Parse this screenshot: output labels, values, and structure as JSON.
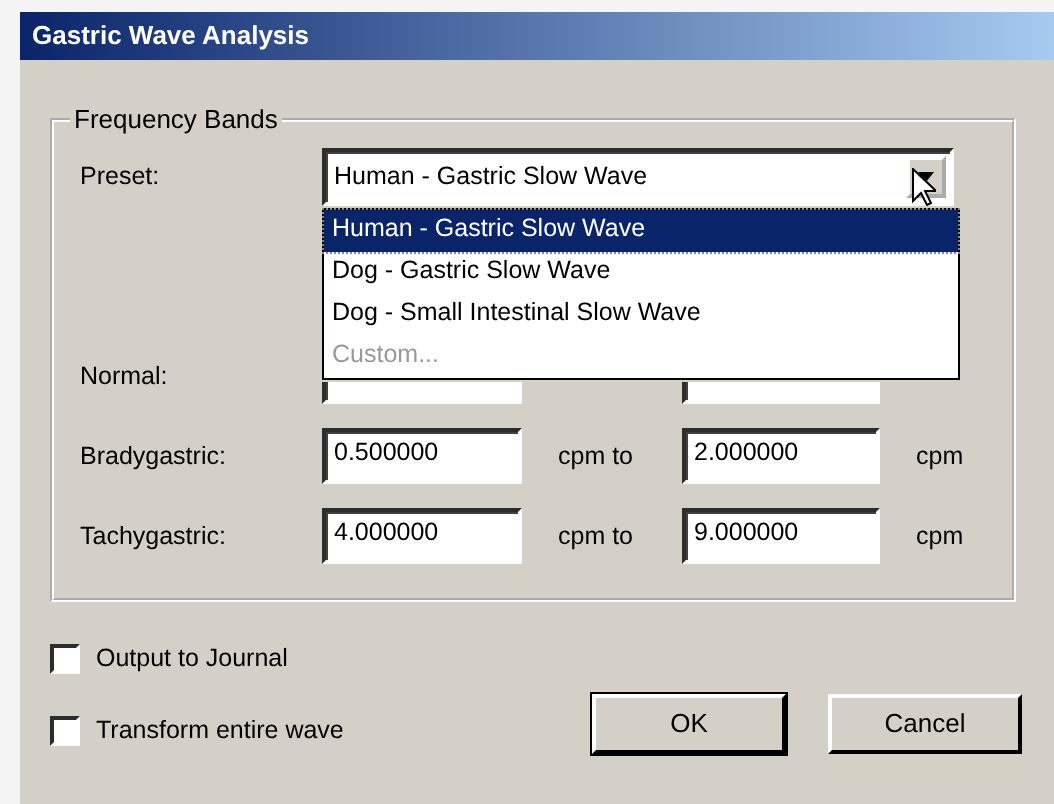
{
  "window": {
    "title": "Gastric Wave Analysis"
  },
  "group": {
    "title": "Frequency Bands"
  },
  "preset": {
    "label": "Preset:",
    "value": "Human - Gastric Slow Wave",
    "expanded": true,
    "options": [
      {
        "label": "Human - Gastric Slow Wave",
        "selected": true,
        "disabled": false
      },
      {
        "label": "Dog - Gastric Slow Wave",
        "selected": false,
        "disabled": false
      },
      {
        "label": "Dog - Small Intestinal Slow Wave",
        "selected": false,
        "disabled": false
      },
      {
        "label": "Custom...",
        "selected": false,
        "disabled": true
      }
    ]
  },
  "bands": [
    {
      "label": "Normal:"
    },
    {
      "label": "Bradygastric:",
      "low": "0.500000",
      "between": "cpm to",
      "high": "2.000000",
      "unit": "cpm"
    },
    {
      "label": "Tachygastric:",
      "low": "4.000000",
      "between": "cpm to",
      "high": "9.000000",
      "unit": "cpm"
    }
  ],
  "checkboxes": [
    {
      "label": "Output to Journal",
      "checked": false
    },
    {
      "label": "Transform entire wave",
      "checked": false
    }
  ],
  "buttons": [
    {
      "label": "OK",
      "default": true
    },
    {
      "label": "Cancel",
      "default": false
    }
  ]
}
